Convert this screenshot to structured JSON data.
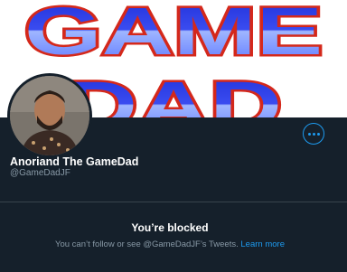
{
  "banner": {
    "line1": "GAME",
    "line2": "DAD"
  },
  "profile": {
    "name": "Anoriand The GameDad",
    "handle": "@GameDadJF"
  },
  "more_icon": "more-horizontal-icon",
  "blocked": {
    "title": "You’re blocked",
    "message": "You can’t follow or see @GameDadJF’s Tweets.",
    "link": "Learn more"
  },
  "colors": {
    "background": "#15202b",
    "accent": "#1d9bf0",
    "secondary_text": "#8899a6"
  }
}
